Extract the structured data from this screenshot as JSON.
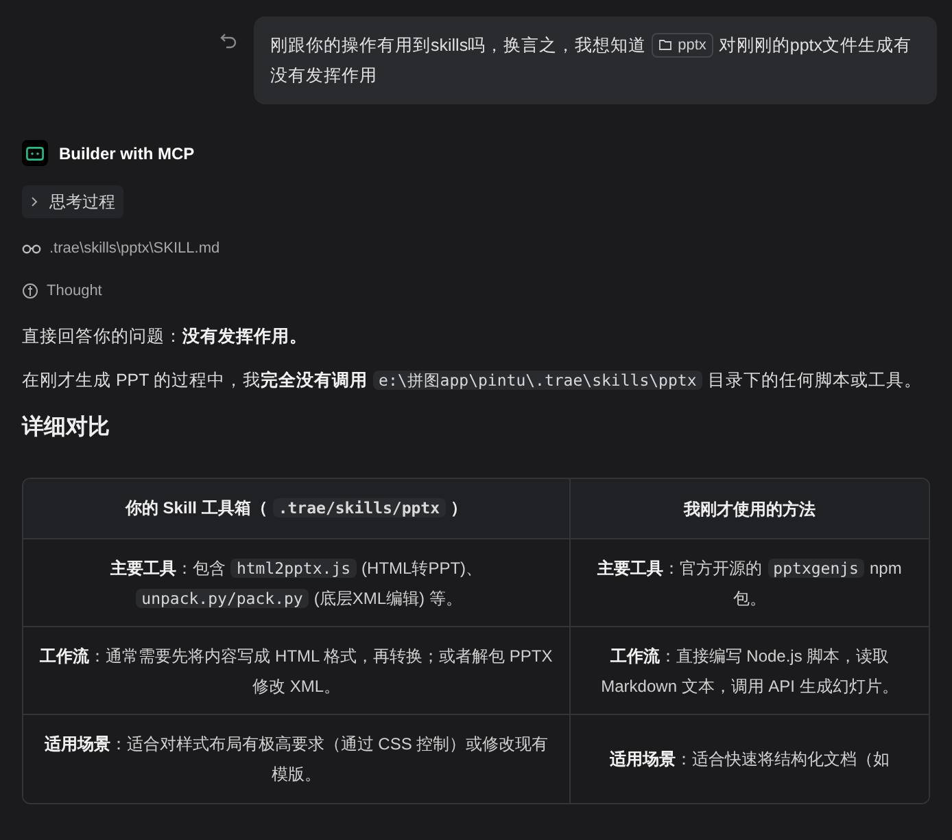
{
  "user_message": {
    "segments": [
      {
        "kind": "text",
        "text": "刚跟你的操作有用到skills吗，换言之，我想知道"
      },
      {
        "kind": "chip",
        "text": "pptx"
      },
      {
        "kind": "text",
        "text": "对刚刚的pptx文件生成有没有发挥作用"
      }
    ]
  },
  "agent": {
    "name": "Builder with MCP"
  },
  "thinking": {
    "label": "思考过程",
    "expanded": false
  },
  "steps": [
    {
      "kind": "read",
      "text": ".trae\\skills\\pptx\\SKILL.md"
    },
    {
      "kind": "thought",
      "text": "Thought"
    }
  ],
  "paragraphs": [
    {
      "segments": [
        {
          "kind": "text",
          "text": "直接回答你的问题："
        },
        {
          "kind": "bold",
          "text": "没有发挥作用。"
        }
      ]
    },
    {
      "segments": [
        {
          "kind": "text",
          "text": "在刚才生成 PPT 的过程中，我"
        },
        {
          "kind": "bold",
          "text": "完全没有调用"
        },
        {
          "kind": "code",
          "text": "e:\\拼图app\\pintu\\.trae\\skills\\pptx"
        },
        {
          "kind": "text",
          "text": "目录下的任何脚本或工具。"
        }
      ]
    }
  ],
  "heading": "详细对比",
  "table": {
    "columns": [
      {
        "segments": [
          {
            "kind": "text",
            "text": "你的 Skill 工具箱（"
          },
          {
            "kind": "code",
            "text": ".trae/skills/pptx"
          },
          {
            "kind": "text",
            "text": "）"
          }
        ]
      },
      {
        "segments": [
          {
            "kind": "text",
            "text": "我刚才使用的方法"
          }
        ]
      }
    ],
    "rows": [
      {
        "cells": [
          {
            "segments": [
              {
                "kind": "bold",
                "text": "主要工具"
              },
              {
                "kind": "text",
                "text": "：包含"
              },
              {
                "kind": "code",
                "text": "html2pptx.js"
              },
              {
                "kind": "text",
                "text": "(HTML转PPT)、"
              },
              {
                "kind": "code",
                "text": "unpack.py/pack.py"
              },
              {
                "kind": "text",
                "text": "(底层XML编辑) 等。"
              }
            ]
          },
          {
            "segments": [
              {
                "kind": "bold",
                "text": "主要工具"
              },
              {
                "kind": "text",
                "text": "：官方开源的"
              },
              {
                "kind": "code",
                "text": "pptxgenjs"
              },
              {
                "kind": "text",
                "text": "npm 包。"
              }
            ]
          }
        ]
      },
      {
        "cells": [
          {
            "segments": [
              {
                "kind": "bold",
                "text": "工作流"
              },
              {
                "kind": "text",
                "text": "：通常需要先将内容写成 HTML 格式，再转换；或者解包 PPTX 修改 XML。"
              }
            ]
          },
          {
            "segments": [
              {
                "kind": "bold",
                "text": "工作流"
              },
              {
                "kind": "text",
                "text": "：直接编写 Node.js 脚本，读取 Markdown 文本，调用 API 生成幻灯片。"
              }
            ]
          }
        ]
      },
      {
        "cells": [
          {
            "segments": [
              {
                "kind": "bold",
                "text": "适用场景"
              },
              {
                "kind": "text",
                "text": "：适合对样式布局有极高要求（通过 CSS 控制）或修改现有模版。"
              }
            ]
          },
          {
            "segments": [
              {
                "kind": "bold",
                "text": "适用场景"
              },
              {
                "kind": "text",
                "text": "：适合快速将结构化文档（如"
              }
            ]
          }
        ]
      }
    ]
  }
}
